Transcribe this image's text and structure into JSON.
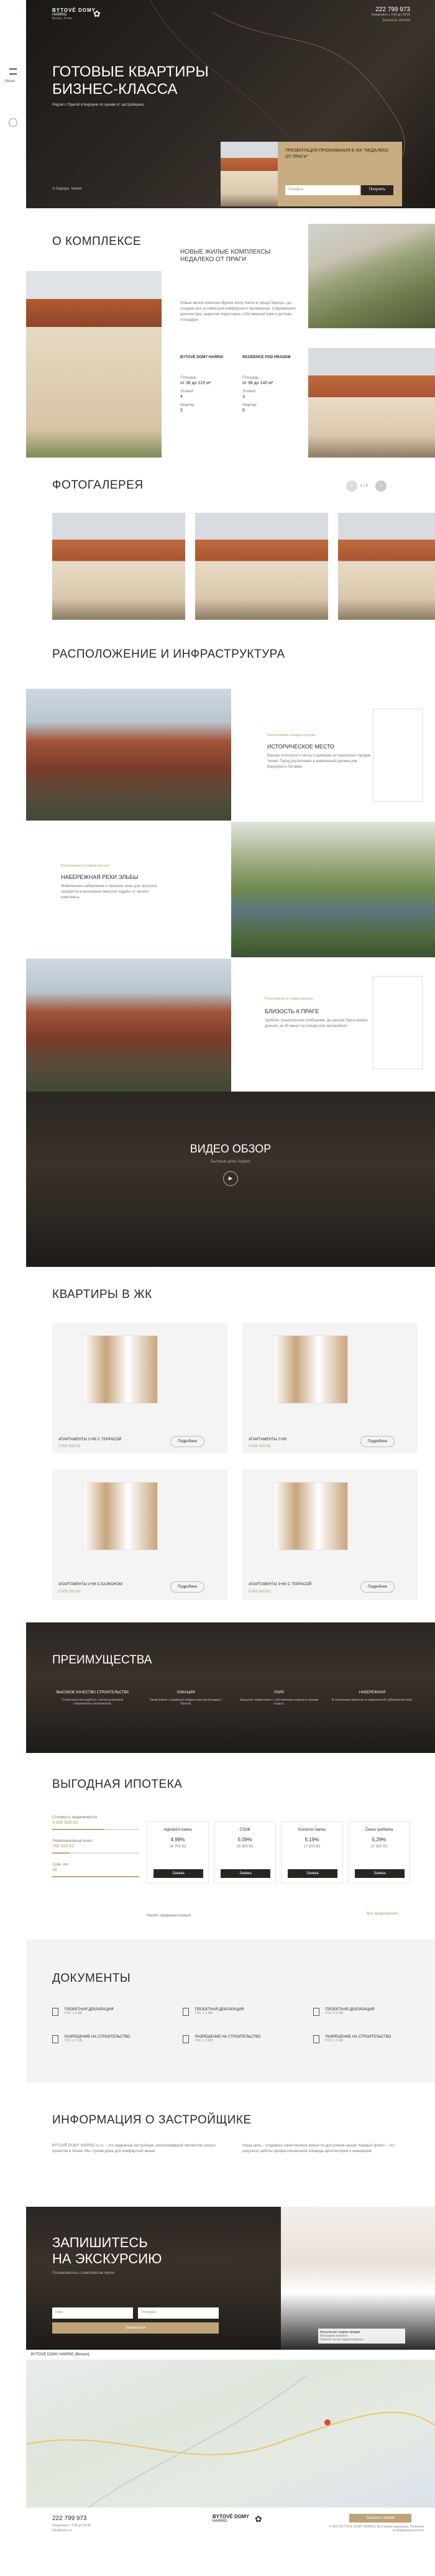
{
  "header": {
    "logo": "BYTOVÉ DOMY",
    "logo_sub": "HARRIO",
    "logo_sub2": "Beroun, Praha",
    "phone": "222 799 973",
    "phone_note": "Ежедневно с 9:00 до 18:00",
    "callback": "Заказать звонок"
  },
  "side": {
    "menu": "Меню"
  },
  "hero": {
    "title_1": "ГОТОВЫЕ КВАРТИРЫ",
    "title_2": "БИЗНЕС-КЛАССА",
    "subtitle": "Рядом с Прагой в Бероуне по ценам от застройщика",
    "address": "Бероун, Чехия",
    "promo_title": "ПРЕЗЕНТАЦИЯ ПРОЖИВАНИЯ В ЖК \"НЕДАЛЕКО ОТ ПРАГИ\"",
    "promo_input": "Телефон",
    "promo_button": "Получить"
  },
  "about": {
    "title": "О КОМПЛЕКСЕ",
    "heading": "НОВЫЕ ЖИЛЫЕ КОМПЛЕКСЫ НЕДАЛЕКО ОТ ПРАГИ",
    "text": "Новый жилой комплекс Bytové domy Harrio в городе Бероун, где созданы все условия для комфортного проживания. Современная архитектура, закрытая территория, собственный парк и детская площадка.",
    "stats": [
      {
        "label": "Площадь",
        "value": "от 38 до 120 м²"
      },
      {
        "label": "Площадь",
        "value": "от 38 до 140 м²"
      },
      {
        "label": "Этажей",
        "value": "4"
      },
      {
        "label": "Этажей",
        "value": "3"
      },
      {
        "label": "Квартир",
        "value": "3"
      },
      {
        "label": "Квартир",
        "value": "6"
      }
    ],
    "logo1": "BYTOVÉ DOMY HARRIO",
    "logo2": "REZIDENCE POD HRADEM"
  },
  "gallery": {
    "title": "ФОТОГАЛЕРЕЯ",
    "counter": "1 / 3"
  },
  "location": {
    "title": "РАСПОЛОЖЕНИЕ И ИНФРАСТРУКТУРА",
    "items": [
      {
        "tag": "Расположение и инфраструктура",
        "heading": "ИСТОРИЧЕСКОЕ МЕСТО",
        "text": "Бероун относится к числу старейших исторических городов Чехии. Город расположен в живописной долине рек Бероунка и Литавка."
      },
      {
        "tag": "Расположение и инфраструктура",
        "heading": "НАБЕРЕЖНАЯ РЕКИ ЭЛЬБЫ",
        "text": "Живописная набережная и зеленые зоны для прогулок находятся в нескольких минутах ходьбы от жилого комплекса."
      },
      {
        "tag": "Расположение и инфраструктура",
        "heading": "БЛИЗОСТЬ К ПРАГЕ",
        "text": "Удобное транспортное сообщение: до центра Праги можно доехать за 30 минут на поезде или автомобиле."
      }
    ]
  },
  "video": {
    "title": "ВИДЕО ОБЗОР",
    "subtitle": "Бытовые дома Харрио"
  },
  "apartments": {
    "title": "КВАРТИРЫ В ЖК",
    "items": [
      {
        "name": "АПАРТАМЕНТЫ 1+КК С ТЕРРАСОЙ",
        "price": "3 900 000 Kč",
        "button": "Подробнее"
      },
      {
        "name": "АПАРТАМЕНТЫ 2+КК",
        "price": "4 900 000 Kč",
        "button": "Подробнее"
      },
      {
        "name": "АПАРТАМЕНТЫ 2+КК С БАЛКОНОМ",
        "price": "5 500 000 Kč",
        "button": "Подробнее"
      },
      {
        "name": "АПАРТАМЕНТЫ 3+КК С ТЕРРАСОЙ",
        "price": "6 900 000 Kč",
        "button": "Подробнее"
      }
    ]
  },
  "advantages": {
    "title": "ПРЕИМУЩЕСТВА",
    "items": [
      {
        "title": "ВЫСОКОЕ КАЧЕСТВО СТРОИТЕЛЬСТВА",
        "text": "Строительство ведётся с использованием современных материалов."
      },
      {
        "title": "ЛОКАЦИЯ",
        "text": "Тихий район с развитой инфраструктурой рядом с Прагой."
      },
      {
        "title": "ПАРК",
        "text": "Закрытая территория с собственным парком и зонами отдыха."
      },
      {
        "title": "НАБЕРЕЖНАЯ",
        "text": "В нескольких минутах от живописной набережной реки."
      }
    ]
  },
  "mortgage": {
    "title": "ВЫГОДНАЯ ИПОТЕКА",
    "label_price": "Стоимость недвижимости",
    "price": "3 900 000 Kč",
    "label_initial": "Первоначальный взнос",
    "initial": "780 000 Kč",
    "label_term": "Срок, лет",
    "term": "30",
    "banks": [
      {
        "name": "Hypoteční banka",
        "rate": "4,99%",
        "payment": "16 700 Kč",
        "button": "Заявка"
      },
      {
        "name": "ČSOB",
        "rate": "5,09%",
        "payment": "16 900 Kč",
        "button": "Заявка"
      },
      {
        "name": "Komerční banka",
        "rate": "5,19%",
        "payment": "17 100 Kč",
        "button": "Заявка"
      },
      {
        "name": "Česká spořitelna",
        "rate": "5,29%",
        "payment": "17 300 Kč",
        "button": "Заявка"
      }
    ],
    "note": "Расчёт предварительный",
    "all_banks": "Все предложения"
  },
  "documents": {
    "title": "ДОКУМЕНТЫ",
    "items": [
      {
        "name": "ПРОЕКТНАЯ ДЕКЛАРАЦИЯ",
        "size": "PDF, 1.2 MB"
      },
      {
        "name": "ПРОЕКТНАЯ ДЕКЛАРАЦИЯ",
        "size": "PDF, 1.4 MB"
      },
      {
        "name": "ПРОЕКТНАЯ ДЕКЛАРАЦИЯ",
        "size": "PDF, 0.9 MB"
      },
      {
        "name": "РАЗРЕШЕНИЕ НА СТРОИТЕЛЬСТВО",
        "size": "PDF, 2.1 MB"
      },
      {
        "name": "РАЗРЕШЕНИЕ НА СТРОИТЕЛЬСТВО",
        "size": "PDF, 1.8 MB"
      },
      {
        "name": "РАЗРЕШЕНИЕ НА СТРОИТЕЛЬСТВО",
        "size": "PDF, 1.6 MB"
      }
    ]
  },
  "developer": {
    "title": "ИНФОРМАЦИЯ О ЗАСТРОЙЩИКЕ",
    "text1": "BYTOVÉ DOMY HARRIO s.r.o. – это надёжный застройщик, реализовавший множество жилых проектов в Чехии. Мы строим дома для комфортной жизни.",
    "text2": "Наша цель – создавать качественное жильё по доступным ценам. Каждый проект – это результат работы профессиональной команды архитекторов и инженеров."
  },
  "excursion": {
    "title_1": "ЗАПИШИТЕСЬ",
    "title_2": "НА ЭКСКУРСИЮ",
    "subtitle": "Познакомьтесь с комплексом лично",
    "input_name": "Имя",
    "input_phone": "Телефон",
    "button": "Записаться",
    "agent_name": "Консультант отдела продаж",
    "agent_role": "Менеджер проекта",
    "agent_note": "Ответит на все ваши вопросы"
  },
  "map": {
    "bar": "BYTOVÉ DOMY HARRIO (Beroun)"
  },
  "footer": {
    "phone": "222 799 973",
    "phone_note": "Ежедневно с 9:00 до 18:00",
    "email": "info@harrio.cz",
    "logo": "BYTOVÉ DOMY",
    "logo_sub": "HARRIO",
    "button": "Заказать звонок",
    "copyright": "© 2021 BYTOVÉ DOMY HARRIO. Все права защищены. Политика конфиденциальности"
  },
  "colors": {
    "accent": "#bfa47a",
    "dark": "#1f1c19"
  }
}
